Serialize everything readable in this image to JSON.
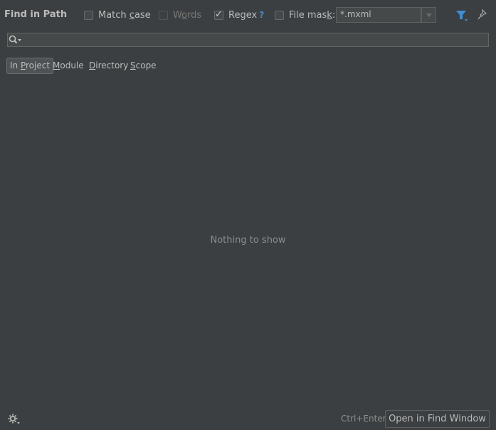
{
  "header": {
    "title": "Find in Path",
    "options": {
      "match_case": {
        "label": "Match case",
        "checked": false,
        "enabled": true
      },
      "words": {
        "label": "Words",
        "checked": false,
        "enabled": false
      },
      "regex": {
        "label": "Regex",
        "checked": true,
        "enabled": true,
        "help": "?"
      },
      "file_mask": {
        "label": "File mask:",
        "checked": false,
        "enabled": true
      }
    },
    "file_mask_value": "*.mxml",
    "icons": {
      "filter": "filter-icon",
      "pin": "pin-icon"
    }
  },
  "search": {
    "value": "",
    "icon": "search-history-icon"
  },
  "scope_tabs": [
    {
      "label": "In Project",
      "selected": true
    },
    {
      "label": "Module",
      "selected": false
    },
    {
      "label": "Directory",
      "selected": false
    },
    {
      "label": "Scope",
      "selected": false
    }
  ],
  "results": {
    "empty_text": "Nothing to show"
  },
  "footer": {
    "settings_icon": "gear-icon",
    "shortcut": "Ctrl+Enter",
    "open_button_label": "Open in Find Window"
  },
  "colors": {
    "background": "#3c3f41",
    "accent_blue": "#4a88c7",
    "text": "#bbbbbb",
    "muted_text": "#8c8c8c"
  }
}
